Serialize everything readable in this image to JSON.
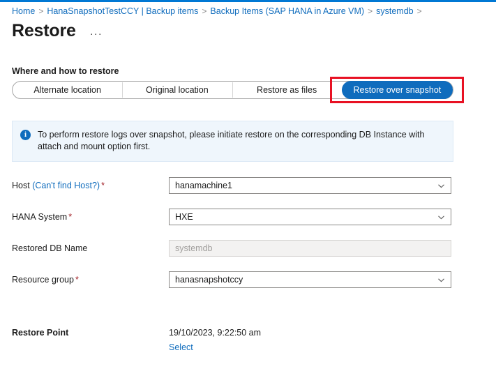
{
  "breadcrumb": {
    "separator": ">",
    "items": [
      {
        "label": "Home"
      },
      {
        "label": "HanaSnapshotTestCCY | Backup items"
      },
      {
        "label": "Backup Items (SAP HANA in Azure VM)"
      },
      {
        "label": "systemdb"
      }
    ]
  },
  "header": {
    "title": "Restore",
    "more_label": "···"
  },
  "section": {
    "label": "Where and how to restore"
  },
  "tabs": {
    "items": [
      {
        "label": "Alternate location",
        "selected": false
      },
      {
        "label": "Original location",
        "selected": false
      },
      {
        "label": "Restore as files",
        "selected": false
      },
      {
        "label": "Restore over snapshot",
        "selected": true
      }
    ],
    "selected_color": "#0f6cbd",
    "highlight_color": "#e81123"
  },
  "info": {
    "icon": "info-icon",
    "text": "To perform restore logs over snapshot, please initiate restore on the corresponding DB Instance with attach and mount option first.",
    "background": "#eff6fc"
  },
  "form": {
    "fields": [
      {
        "label_prefix": "Host ",
        "label_link": "(Can't find Host?)",
        "required": true,
        "value": "hanamachine1",
        "type": "dropdown",
        "disabled": false
      },
      {
        "label_prefix": "HANA System",
        "label_link": "",
        "required": true,
        "value": "HXE",
        "type": "dropdown",
        "disabled": false
      },
      {
        "label_prefix": "Restored DB Name",
        "label_link": "",
        "required": false,
        "value": "systemdb",
        "type": "text",
        "disabled": true
      },
      {
        "label_prefix": "Resource group",
        "label_link": "",
        "required": true,
        "value": "hanasnapshotccy",
        "type": "dropdown",
        "disabled": false
      }
    ],
    "required_marker": "*"
  },
  "restore_point": {
    "label": "Restore Point",
    "value": "19/10/2023, 9:22:50 am",
    "select_label": "Select"
  }
}
